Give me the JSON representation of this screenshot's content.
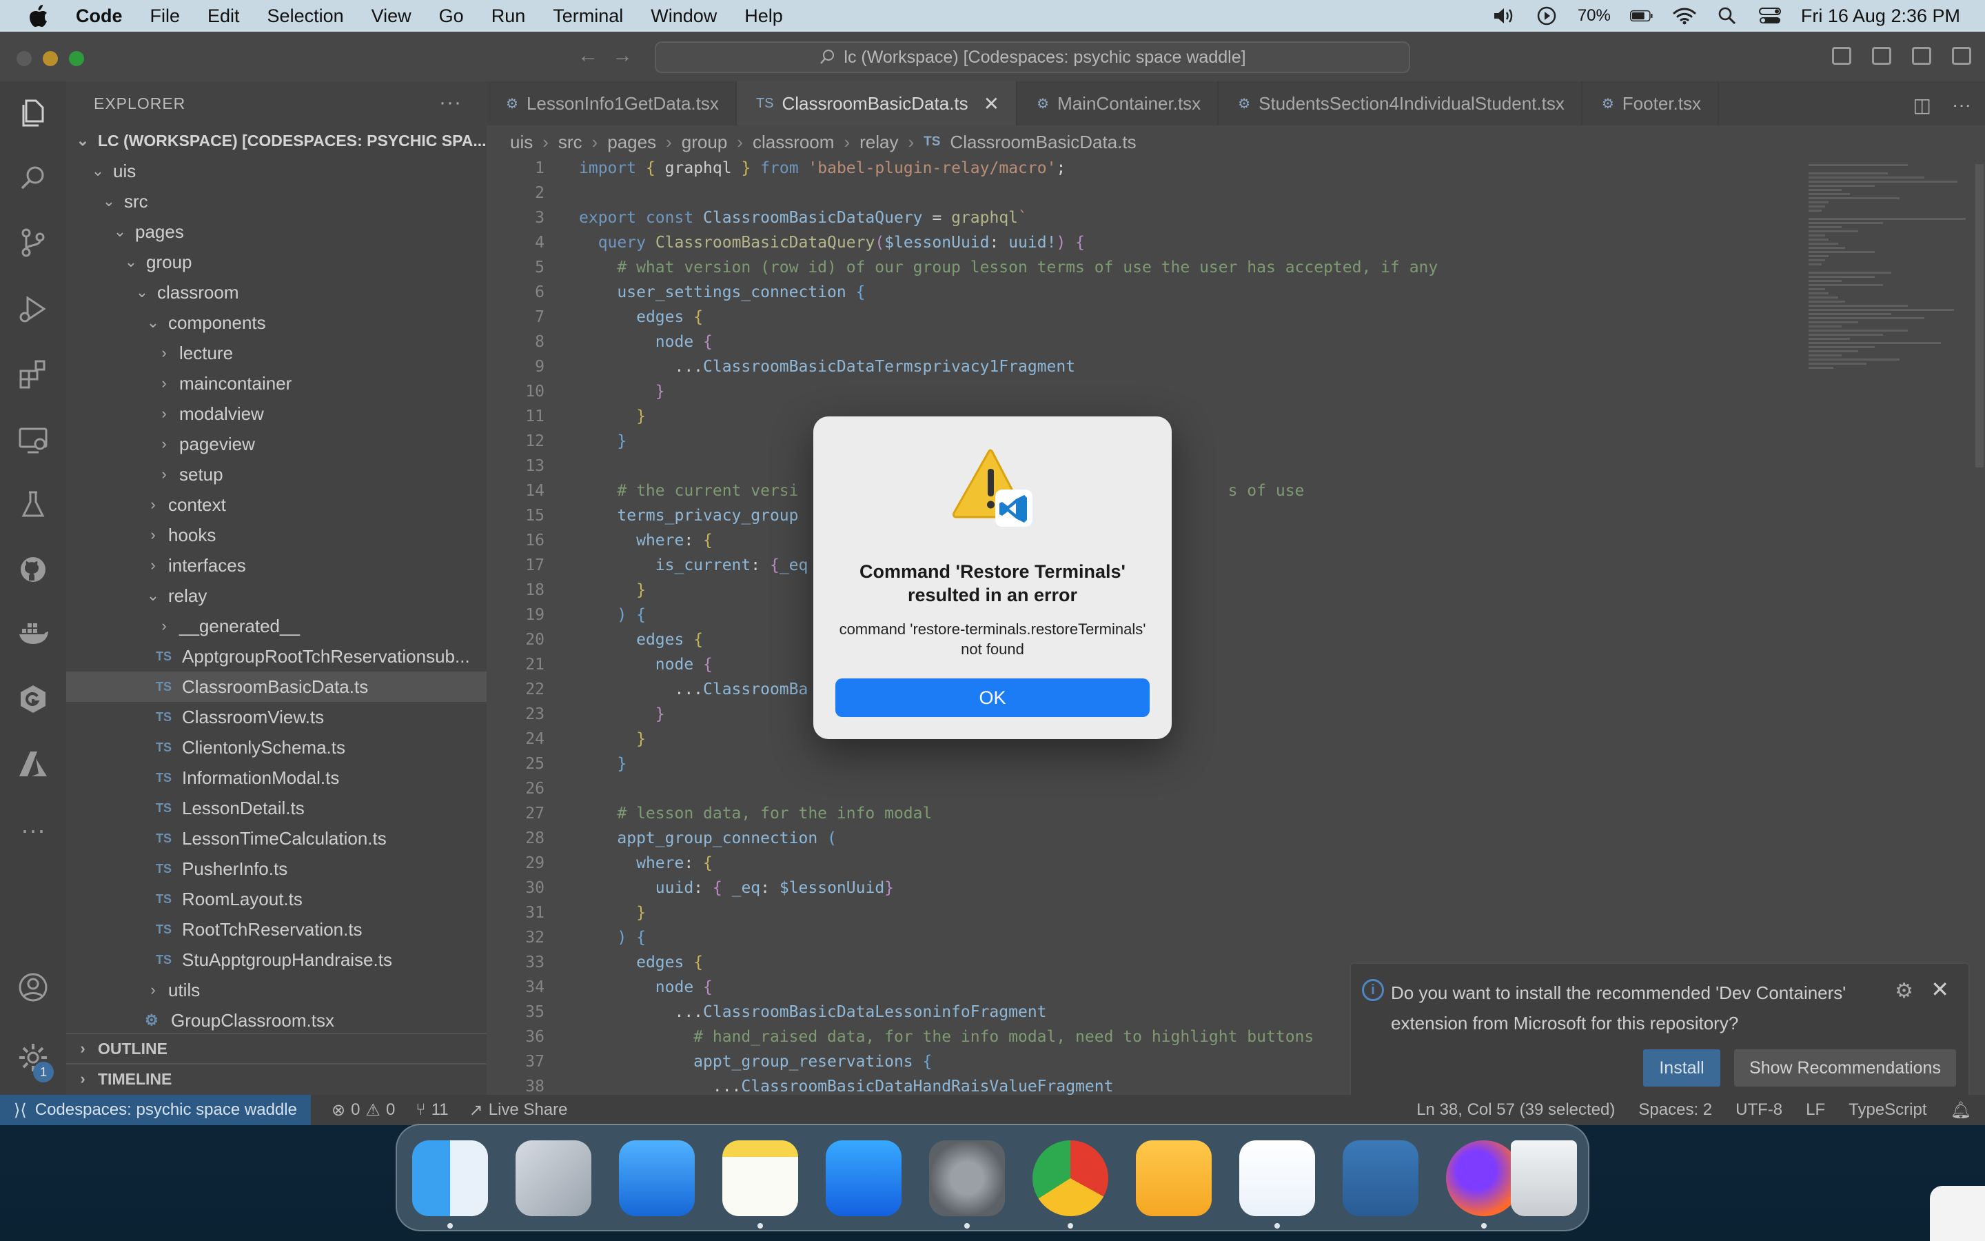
{
  "menubar": {
    "app_name": "Code",
    "items": [
      "File",
      "Edit",
      "Selection",
      "View",
      "Go",
      "Run",
      "Terminal",
      "Window",
      "Help"
    ],
    "battery": "70%",
    "datetime": "Fri 16 Aug  2:36 PM"
  },
  "window": {
    "command_center": "lc (Workspace) [Codespaces: psychic space waddle]"
  },
  "sidebar": {
    "title": "EXPLORER",
    "workspace": "LC (WORKSPACE) [CODESPACES: PSYCHIC SPA...",
    "tree": [
      {
        "label": "uis",
        "depth": 0,
        "type": "folder-open"
      },
      {
        "label": "src",
        "depth": 1,
        "type": "folder-open"
      },
      {
        "label": "pages",
        "depth": 2,
        "type": "folder-open"
      },
      {
        "label": "group",
        "depth": 3,
        "type": "folder-open"
      },
      {
        "label": "classroom",
        "depth": 4,
        "type": "folder-open"
      },
      {
        "label": "components",
        "depth": 5,
        "type": "folder-open"
      },
      {
        "label": "lecture",
        "depth": 6,
        "type": "folder"
      },
      {
        "label": "maincontainer",
        "depth": 6,
        "type": "folder"
      },
      {
        "label": "modalview",
        "depth": 6,
        "type": "folder"
      },
      {
        "label": "pageview",
        "depth": 6,
        "type": "folder"
      },
      {
        "label": "setup",
        "depth": 6,
        "type": "folder"
      },
      {
        "label": "context",
        "depth": 5,
        "type": "folder"
      },
      {
        "label": "hooks",
        "depth": 5,
        "type": "folder"
      },
      {
        "label": "interfaces",
        "depth": 5,
        "type": "folder"
      },
      {
        "label": "relay",
        "depth": 5,
        "type": "folder-open"
      },
      {
        "label": "__generated__",
        "depth": 6,
        "type": "folder"
      },
      {
        "label": "ApptgroupRootTchReservationsub...",
        "depth": 6,
        "type": "ts"
      },
      {
        "label": "ClassroomBasicData.ts",
        "depth": 6,
        "type": "ts",
        "selected": true
      },
      {
        "label": "ClassroomView.ts",
        "depth": 6,
        "type": "ts"
      },
      {
        "label": "ClientonlySchema.ts",
        "depth": 6,
        "type": "ts"
      },
      {
        "label": "InformationModal.ts",
        "depth": 6,
        "type": "ts"
      },
      {
        "label": "LessonDetail.ts",
        "depth": 6,
        "type": "ts"
      },
      {
        "label": "LessonTimeCalculation.ts",
        "depth": 6,
        "type": "ts"
      },
      {
        "label": "PusherInfo.ts",
        "depth": 6,
        "type": "ts"
      },
      {
        "label": "RoomLayout.ts",
        "depth": 6,
        "type": "ts"
      },
      {
        "label": "RootTchReservation.ts",
        "depth": 6,
        "type": "ts"
      },
      {
        "label": "StuApptgroupHandraise.ts",
        "depth": 6,
        "type": "ts"
      },
      {
        "label": "utils",
        "depth": 5,
        "type": "folder"
      },
      {
        "label": "GroupClassroom.tsx",
        "depth": 5,
        "type": "tsx"
      }
    ],
    "outline": "OUTLINE",
    "timeline": "TIMELINE"
  },
  "editor": {
    "tabs": [
      {
        "label": "LessonInfo1GetData.tsx",
        "icon": "gear-icon",
        "active": false
      },
      {
        "label": "ClassroomBasicData.ts",
        "icon": "TS",
        "active": true
      },
      {
        "label": "MainContainer.tsx",
        "icon": "gear-icon",
        "active": false
      },
      {
        "label": "StudentsSection4IndividualStudent.tsx",
        "icon": "gear-icon",
        "active": false
      },
      {
        "label": "Footer.tsx",
        "icon": "gear-icon",
        "active": false
      }
    ],
    "breadcrumb": [
      "uis",
      "src",
      "pages",
      "group",
      "classroom",
      "relay",
      "ClassroomBasicData.ts"
    ],
    "breadcrumb_file_icon": "TS",
    "lines": [
      {
        "n": "1",
        "html": "<span class=\"kw\">import</span> <span class=\"br1\">{</span> graphql <span class=\"br1\">}</span> <span class=\"kw\">from</span> <span class=\"str\">'babel-plugin-relay/macro'</span>;"
      },
      {
        "n": "2",
        "html": ""
      },
      {
        "n": "3",
        "html": "<span class=\"kw\">export const</span> <span class=\"var\">ClassroomBasicDataQuery</span> = <span class=\"fn\">graphql</span><span class=\"str\">`</span>"
      },
      {
        "n": "4",
        "html": "  <span class=\"kw\">query</span> <span class=\"fn\">ClassroomBasicDataQuery</span><span class=\"br2\">(</span><span class=\"var\">$lessonUuid</span>: <span class=\"var\">uuid!</span><span class=\"br2\">)</span> <span class=\"br2\">{</span>"
      },
      {
        "n": "5",
        "html": "    <span class=\"cm\"># what version (row id) of our group lesson terms of use the user has accepted, if any</span>"
      },
      {
        "n": "6",
        "html": "    <span class=\"var\">user_settings_connection</span> <span class=\"br3\">{</span>"
      },
      {
        "n": "7",
        "html": "      <span class=\"var\">edges</span> <span class=\"br1\">{</span>"
      },
      {
        "n": "8",
        "html": "        <span class=\"var\">node</span> <span class=\"br2\">{</span>"
      },
      {
        "n": "9",
        "html": "          ...<span class=\"var\">ClassroomBasicDataTermsprivacy1Fragment</span>"
      },
      {
        "n": "10",
        "html": "        <span class=\"br2\">}</span>"
      },
      {
        "n": "11",
        "html": "      <span class=\"br1\">}</span>"
      },
      {
        "n": "12",
        "html": "    <span class=\"br3\">}</span>"
      },
      {
        "n": "13",
        "html": ""
      },
      {
        "n": "14",
        "html": "    <span class=\"cm\"># the current versi                                             s of use</span>"
      },
      {
        "n": "15",
        "html": "    <span class=\"var\">terms_privacy_group</span>"
      },
      {
        "n": "16",
        "html": "      <span class=\"var\">where</span>: <span class=\"br1\">{</span>"
      },
      {
        "n": "17",
        "html": "        <span class=\"var\">is_current</span>: <span class=\"br2\">{</span><span class=\"var\">_eq</span>"
      },
      {
        "n": "18",
        "html": "      <span class=\"br1\">}</span>"
      },
      {
        "n": "19",
        "html": "    <span class=\"br3\">)</span> <span class=\"br3\">{</span>"
      },
      {
        "n": "20",
        "html": "      <span class=\"var\">edges</span> <span class=\"br1\">{</span>"
      },
      {
        "n": "21",
        "html": "        <span class=\"var\">node</span> <span class=\"br2\">{</span>"
      },
      {
        "n": "22",
        "html": "          ...<span class=\"var\">ClassroomBa</span>"
      },
      {
        "n": "23",
        "html": "        <span class=\"br2\">}</span>"
      },
      {
        "n": "24",
        "html": "      <span class=\"br1\">}</span>"
      },
      {
        "n": "25",
        "html": "    <span class=\"br3\">}</span>"
      },
      {
        "n": "26",
        "html": ""
      },
      {
        "n": "27",
        "html": "    <span class=\"cm\"># lesson data, for the info modal</span>"
      },
      {
        "n": "28",
        "html": "    <span class=\"var\">appt_group_connection</span> <span class=\"br3\">(</span>"
      },
      {
        "n": "29",
        "html": "      <span class=\"var\">where</span>: <span class=\"br1\">{</span>"
      },
      {
        "n": "30",
        "html": "        <span class=\"var\">uuid</span>: <span class=\"br2\">{</span> <span class=\"var\">_eq</span>: <span class=\"var\">$lessonUuid</span><span class=\"br2\">}</span>"
      },
      {
        "n": "31",
        "html": "      <span class=\"br1\">}</span>"
      },
      {
        "n": "32",
        "html": "    <span class=\"br3\">)</span> <span class=\"br3\">{</span>"
      },
      {
        "n": "33",
        "html": "      <span class=\"var\">edges</span> <span class=\"br1\">{</span>"
      },
      {
        "n": "34",
        "html": "        <span class=\"var\">node</span> <span class=\"br2\">{</span>"
      },
      {
        "n": "35",
        "html": "          ...<span class=\"var\">ClassroomBasicDataLessoninfoFragment</span>"
      },
      {
        "n": "36",
        "html": "            <span class=\"cm\"># hand_raised data, for the info modal, need to highlight buttons</span>"
      },
      {
        "n": "37",
        "html": "            <span class=\"var\">appt_group_reservations</span> <span class=\"br3\">{</span>"
      },
      {
        "n": "38",
        "html": "              ...<span class=\"var\">ClassroomBasicDataHandRaisValueFragment</span>"
      }
    ]
  },
  "notification": {
    "message": "Do you want to install the recommended 'Dev Containers' extension from Microsoft for this repository?",
    "install_label": "Install",
    "recommendations_label": "Show Recommendations"
  },
  "statusbar": {
    "remote": "Codespaces: psychic space waddle",
    "errors": "0",
    "warnings": "0",
    "ports": "11",
    "liveshare": "Live Share",
    "position": "Ln 38, Col 57 (39 selected)",
    "spaces": "Spaces: 2",
    "encoding": "UTF-8",
    "eol": "LF",
    "language": "TypeScript"
  },
  "dialog": {
    "title": "Command 'Restore Terminals' resulted in an error",
    "body": "command 'restore-terminals.restoreTerminals' not found",
    "ok_label": "OK"
  },
  "dock": {
    "apps": [
      "finder-icon",
      "launchpad-icon",
      "mail-icon",
      "notes-icon",
      "app-store-icon",
      "system-settings-icon",
      "chrome-icon",
      "sublime-icon",
      "vscode-icon",
      "tableplus-icon",
      "firefox-icon",
      "trash-icon"
    ],
    "running": [
      "finder-icon",
      "notes-icon",
      "system-settings-icon",
      "chrome-icon",
      "vscode-icon",
      "firefox-icon"
    ]
  },
  "colors": {
    "accent": "#1b7cf6",
    "remote_status": "#2d5a84"
  }
}
